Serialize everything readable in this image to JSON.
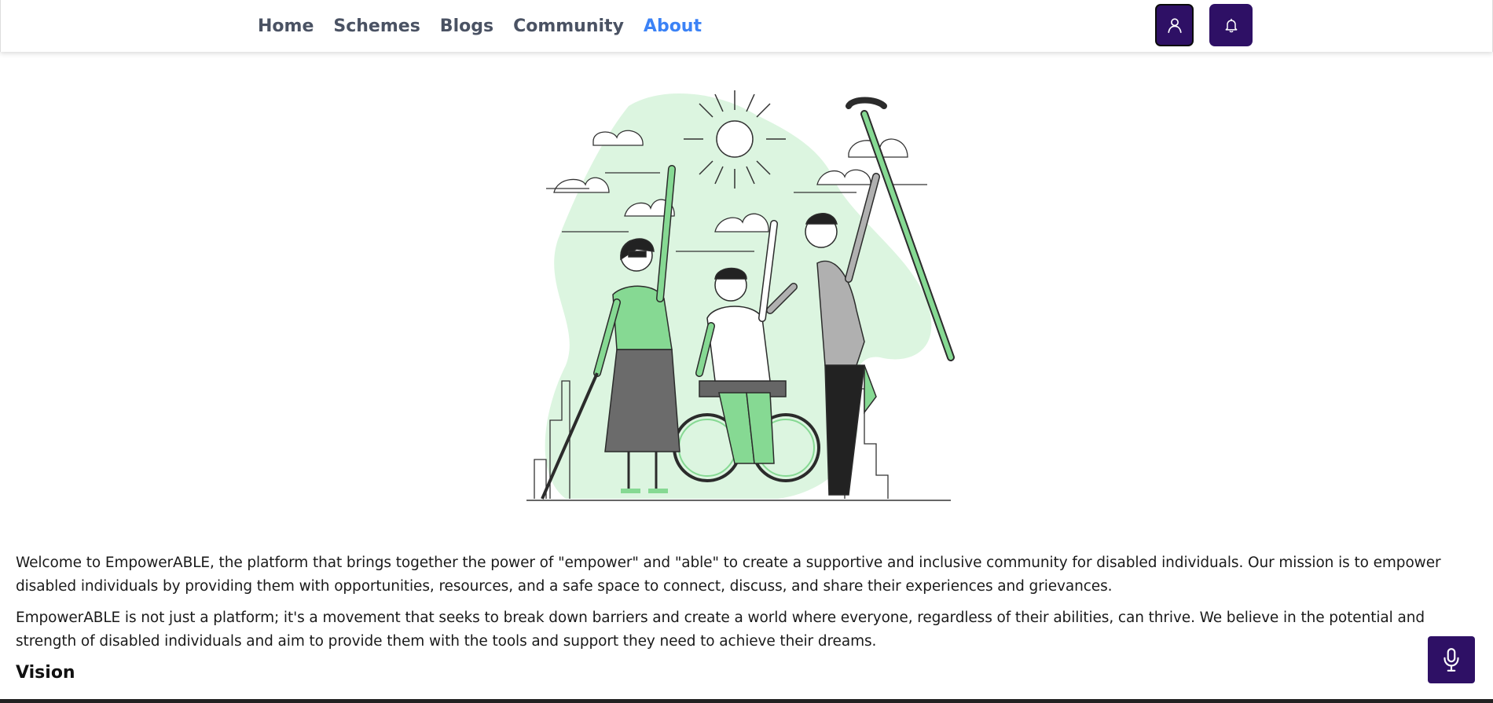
{
  "nav": {
    "items": [
      {
        "label": "Home"
      },
      {
        "label": "Schemes"
      },
      {
        "label": "Blogs"
      },
      {
        "label": "Community"
      },
      {
        "label": "About",
        "active": true
      }
    ],
    "active_color": "#3b82f6",
    "link_color": "#4a5263"
  },
  "header_buttons": {
    "profile_icon": "user-icon",
    "notification_icon": "bell-icon",
    "color": "#2e1065"
  },
  "hero": {
    "illustration": "people-with-disabilities-celebrating"
  },
  "content": {
    "paragraphs": [
      "Welcome to EmpowerABLE, the platform that brings together the power of \"empower\" and \"able\" to create a supportive and inclusive community for disabled individuals. Our mission is to empower disabled individuals by providing them with opportunities, resources, and a safe space to connect, discuss, and share their experiences and grievances.",
      "EmpowerABLE is not just a platform; it's a movement that seeks to break down barriers and create a world where everyone, regardless of their abilities, can thrive. We believe in the potential and strength of disabled individuals and aim to provide them with the tools and support they need to achieve their dreams."
    ],
    "vision_heading": "Vision"
  },
  "voice_button": {
    "icon": "microphone-icon"
  },
  "colors": {
    "accent_green": "#86d993",
    "light_green": "#dcf5e0",
    "brand_purple": "#2e1065"
  }
}
